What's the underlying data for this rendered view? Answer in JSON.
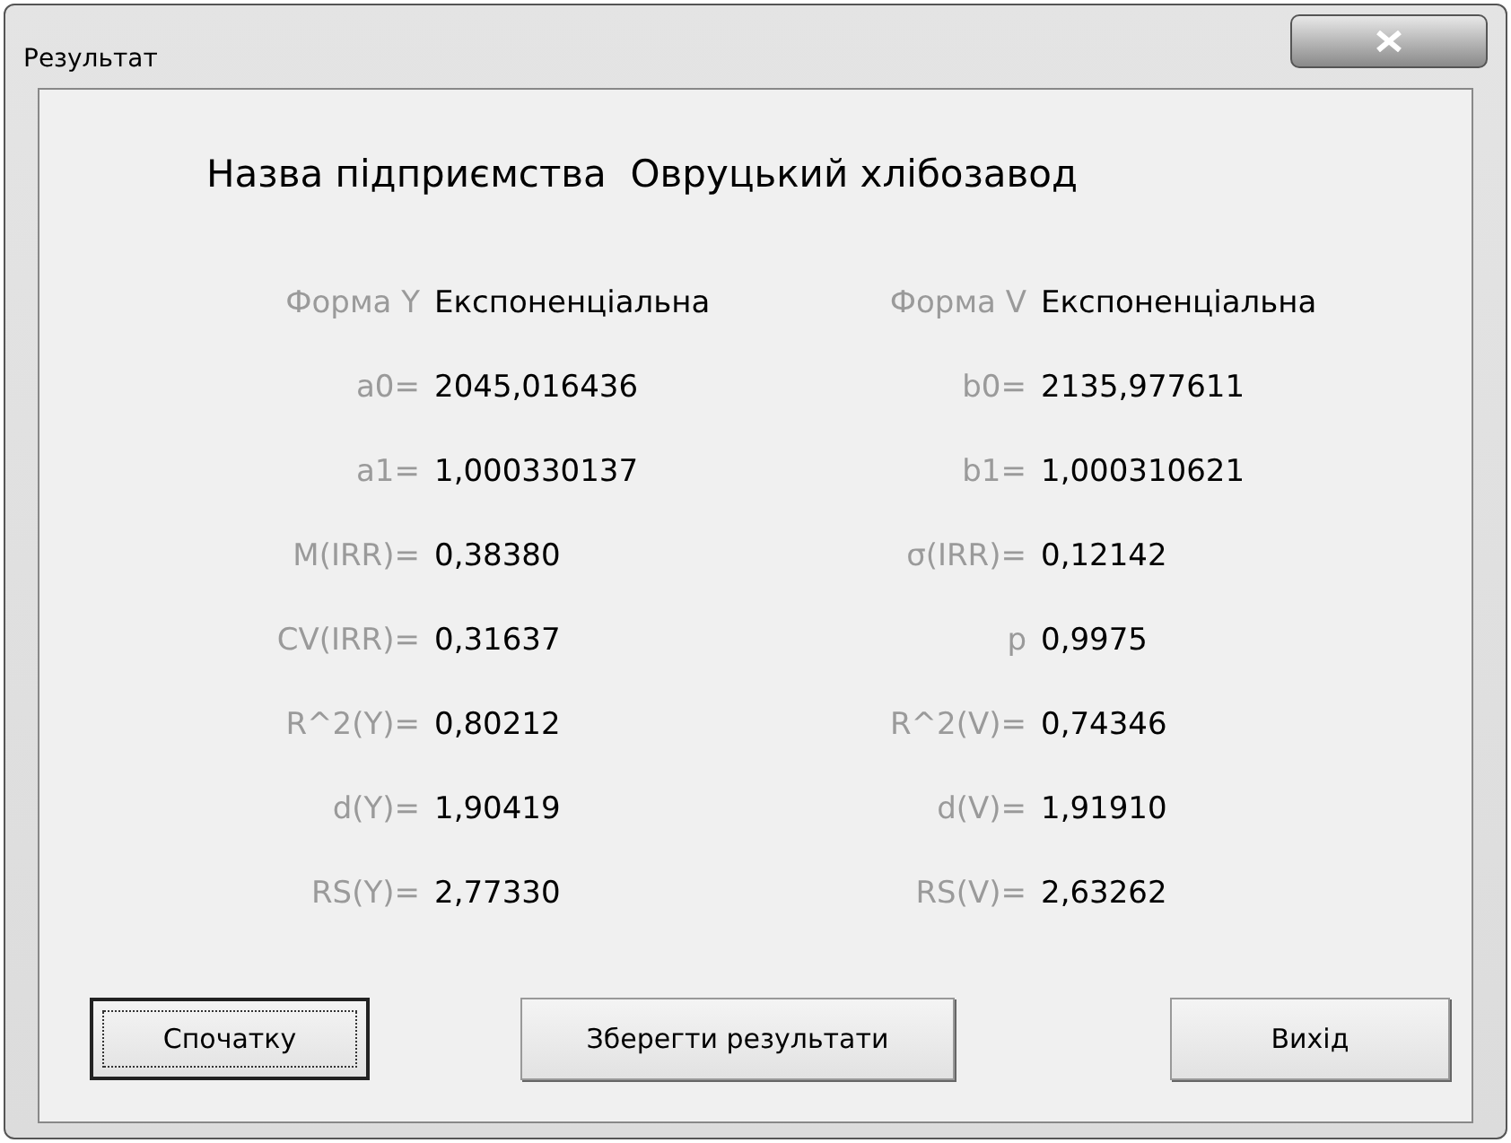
{
  "window": {
    "title": "Результат"
  },
  "heading": "Назва підприємства  Овруцький хлібозавод",
  "rows": [
    {
      "label_1": "Форма Y",
      "value_1": "Експоненціальна",
      "label_2": "Форма V",
      "value_2": "Експоненціальна"
    },
    {
      "label_1": "a0=",
      "value_1": "2045,016436",
      "label_2": "b0=",
      "value_2": "2135,977611"
    },
    {
      "label_1": "a1=",
      "value_1": "1,000330137",
      "label_2": "b1=",
      "value_2": "1,000310621"
    },
    {
      "label_1": "M(IRR)=",
      "value_1": "0,38380",
      "label_2": "σ(IRR)=",
      "value_2": "0,12142"
    },
    {
      "label_1": "CV(IRR)=",
      "value_1": "0,31637",
      "label_2": "p",
      "value_2": "0,9975"
    },
    {
      "label_1": "R^2(Y)=",
      "value_1": "0,80212",
      "label_2": "R^2(V)=",
      "value_2": "0,74346"
    },
    {
      "label_1": "d(Y)=",
      "value_1": "1,90419",
      "label_2": "d(V)=",
      "value_2": "1,91910"
    },
    {
      "label_1": "RS(Y)=",
      "value_1": "2,77330",
      "label_2": "RS(V)=",
      "value_2": "2,63262"
    }
  ],
  "buttons": [
    {
      "label": "Спочатку",
      "focused": true
    },
    {
      "label": "Зберегти результати",
      "focused": false
    },
    {
      "label": "Вихід",
      "focused": false
    }
  ]
}
